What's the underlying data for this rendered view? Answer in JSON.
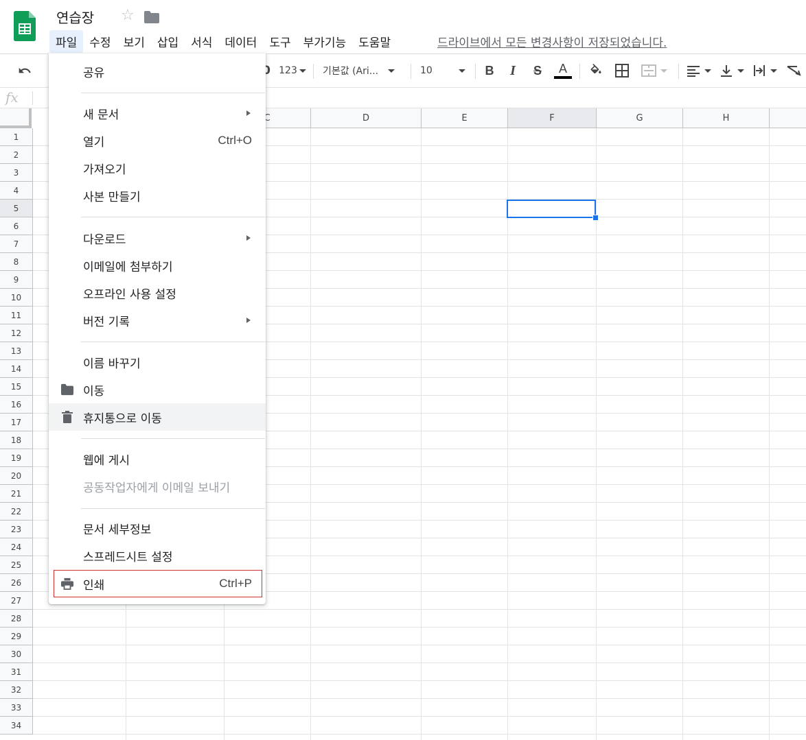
{
  "title_bar": {
    "doc_title": "연습장",
    "save_status": "드라이브에서 모든 변경사항이 저장되었습니다."
  },
  "menubar": {
    "items": [
      "파일",
      "수정",
      "보기",
      "삽입",
      "서식",
      "데이터",
      "도구",
      "부가기능",
      "도움말"
    ],
    "active": "파일"
  },
  "toolbar": {
    "number_format": "123",
    "font": "기본값 (Ari...",
    "font_size": "10",
    "bold": "B",
    "italic": "I",
    "strike": "S",
    "text_color": "A"
  },
  "formula_bar": {
    "fx": "fx"
  },
  "grid": {
    "columns": [
      "C",
      "D",
      "E",
      "F",
      "G",
      "H"
    ],
    "rows": [
      "1",
      "2",
      "3",
      "4",
      "5",
      "6",
      "7",
      "8",
      "9",
      "10",
      "11",
      "12",
      "13",
      "14",
      "15",
      "16",
      "17",
      "18",
      "19",
      "20",
      "21",
      "22",
      "23",
      "24",
      "25",
      "26",
      "27",
      "28",
      "29",
      "30",
      "31",
      "32",
      "33",
      "34"
    ],
    "selected_column": "F",
    "selected_row": "5"
  },
  "file_menu": {
    "share": "공유",
    "new_doc": "새 문서",
    "open": "열기",
    "open_shortcut": "Ctrl+O",
    "import": "가져오기",
    "make_copy": "사본 만들기",
    "download": "다운로드",
    "email_attach": "이메일에 첨부하기",
    "offline": "오프라인 사용 설정",
    "version_history": "버전 기록",
    "rename": "이름 바꾸기",
    "move": "이동",
    "move_to_trash": "휴지통으로 이동",
    "publish_web": "웹에 게시",
    "email_collaborators": "공동작업자에게 이메일 보내기",
    "doc_details": "문서 세부정보",
    "spreadsheet_settings": "스프레드시트 설정",
    "print": "인쇄",
    "print_shortcut": "Ctrl+P"
  },
  "colors": {
    "sheets_green": "#0f9d58",
    "selection_blue": "#1a73e8",
    "highlight_red": "#d32f2f"
  }
}
